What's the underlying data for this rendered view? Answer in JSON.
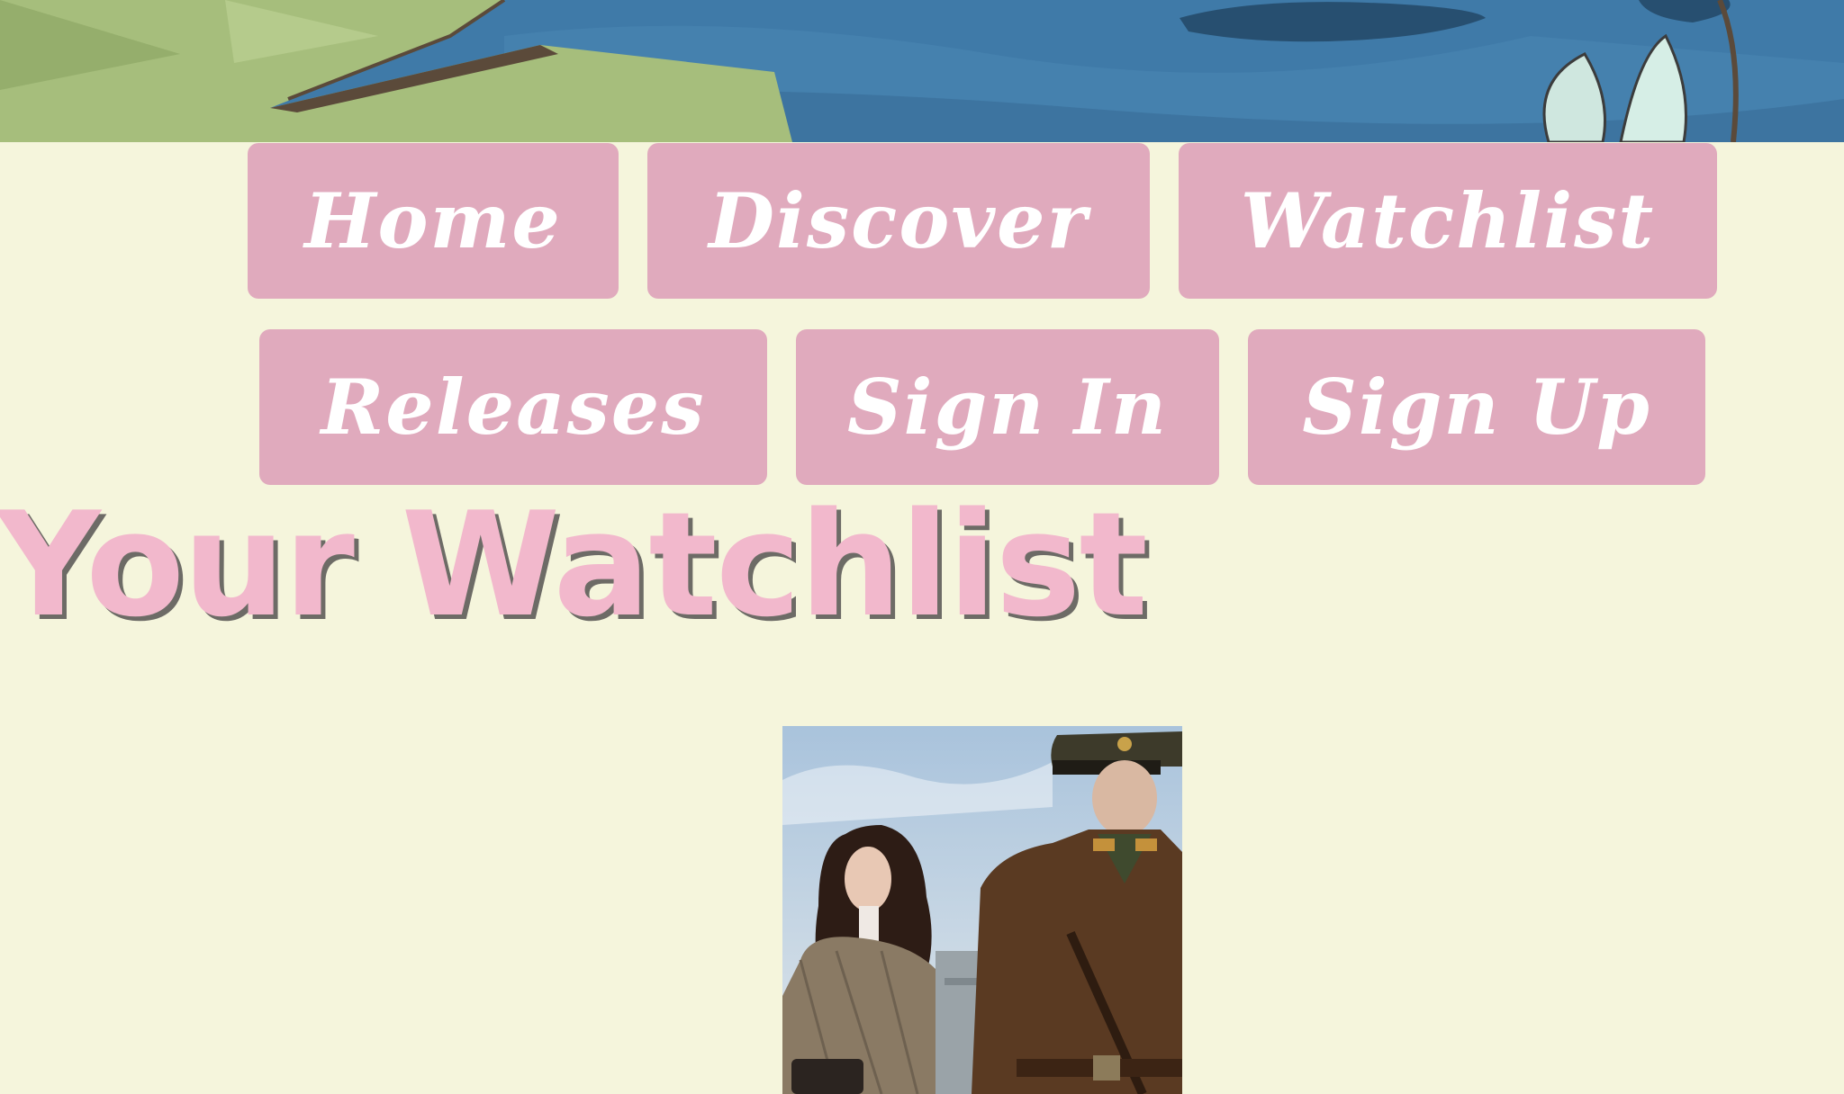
{
  "nav": {
    "home": "Home",
    "discover": "Discover",
    "watchlist": "Watchlist",
    "releases": "Releases",
    "sign_in": "Sign In",
    "sign_up": "Sign Up"
  },
  "page": {
    "title": "Your Watchlist"
  },
  "watchlist": {
    "items": [
      {
        "poster": "drama-poster-image"
      }
    ]
  },
  "colors": {
    "background": "#f5f5dc",
    "button": "#e0aabd",
    "button_text": "#ffffff",
    "title": "#f2b8cc",
    "title_shadow": "#6d6b66"
  }
}
